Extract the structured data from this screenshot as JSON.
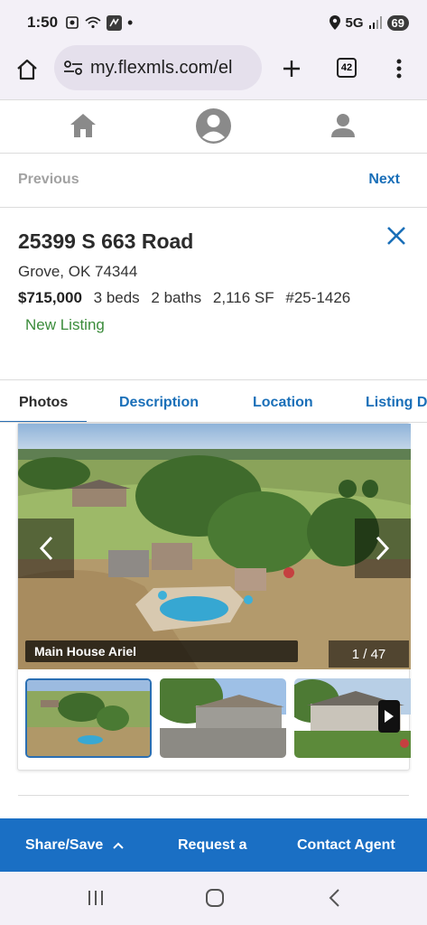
{
  "status_bar": {
    "time": "1:50",
    "network": "5G",
    "battery": "69"
  },
  "browser": {
    "url": "my.flexmls.com/el",
    "tab_count": "42"
  },
  "pager": {
    "previous": "Previous",
    "next": "Next"
  },
  "listing": {
    "address": "25399 S 663 Road",
    "city_state_zip": "Grove, OK 74344",
    "price": "$715,000",
    "beds": "3 beds",
    "baths": "2 baths",
    "sqft": "2,116 SF",
    "mls": "#25-1426",
    "status": "New Listing"
  },
  "tabs": [
    "Photos",
    "Description",
    "Location",
    "Listing D"
  ],
  "photos": {
    "caption": "Main House Ariel",
    "counter": "1 / 47"
  },
  "actions": {
    "share": "Share/Save",
    "request": "Request a",
    "contact": "Contact Agent"
  },
  "colors": {
    "accent": "#1a6fc4",
    "link": "#1a6fb8",
    "status_green": "#3b8c3b"
  }
}
